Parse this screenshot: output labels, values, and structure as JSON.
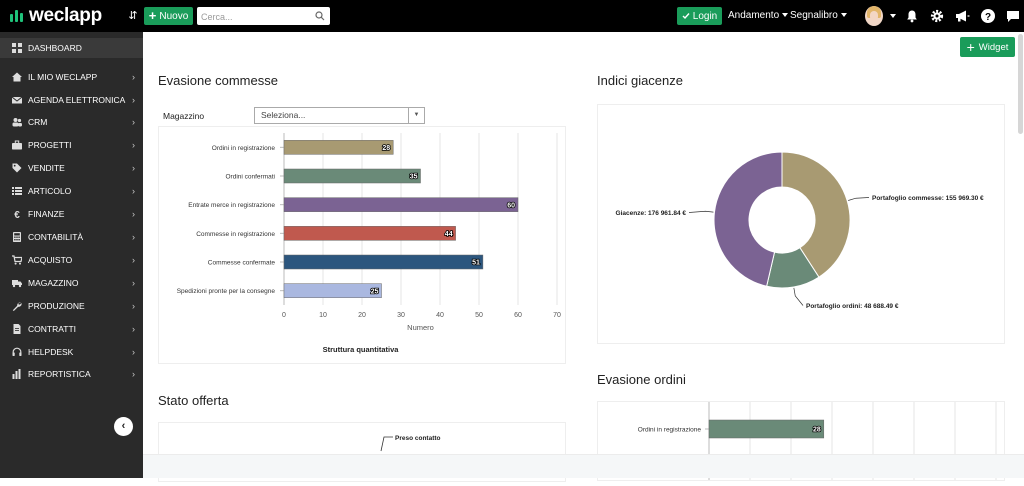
{
  "topbar": {
    "logo_text": "weclapp",
    "collapse_glyph": "⇵",
    "new_button": "Nuovo",
    "search_placeholder": "Cerca...",
    "login_button": "Login",
    "menu_andamento": "Andamento",
    "menu_segnalibro": "Segnalibro",
    "icons": [
      "bell-icon",
      "gear-icon",
      "megaphone-icon",
      "help-icon",
      "chat-icon"
    ]
  },
  "sidebar": {
    "items": [
      {
        "label": "DASHBOARD",
        "icon": "dashboard-icon",
        "active": true,
        "chevron": false
      },
      {
        "label": "IL MIO WECLAPP",
        "icon": "home-icon",
        "chevron": true
      },
      {
        "label": "AGENDA ELETTRONICA",
        "icon": "envelope-icon",
        "chevron": true
      },
      {
        "label": "CRM",
        "icon": "users-icon",
        "chevron": true
      },
      {
        "label": "PROGETTI",
        "icon": "briefcase-icon",
        "chevron": true
      },
      {
        "label": "VENDITE",
        "icon": "tag-icon",
        "chevron": true
      },
      {
        "label": "ARTICOLO",
        "icon": "list-icon",
        "chevron": true
      },
      {
        "label": "FINANZE",
        "icon": "euro-icon",
        "chevron": true
      },
      {
        "label": "CONTABILITÀ",
        "icon": "calculator-icon",
        "chevron": true
      },
      {
        "label": "ACQUISTO",
        "icon": "cart-icon",
        "chevron": true
      },
      {
        "label": "MAGAZZINO",
        "icon": "truck-icon",
        "chevron": true
      },
      {
        "label": "PRODUZIONE",
        "icon": "wrench-icon",
        "chevron": true
      },
      {
        "label": "CONTRATTI",
        "icon": "file-icon",
        "chevron": true
      },
      {
        "label": "HELPDESK",
        "icon": "headset-icon",
        "chevron": true
      },
      {
        "label": "REPORTISTICA",
        "icon": "bar-chart-icon",
        "chevron": true
      }
    ],
    "collapse_glyph": "‹"
  },
  "main": {
    "widget_button": "Widget",
    "evasione_commesse": {
      "title": "Evasione commesse",
      "magazzino_label": "Magazzino",
      "select_value": "Seleziona..."
    },
    "indici_giacenze": {
      "title": "Indici giacenze"
    },
    "stato_offerta": {
      "title": "Stato offerta"
    },
    "evasione_ordini": {
      "title": "Evasione ordini"
    }
  },
  "chart_data": [
    {
      "type": "bar",
      "orientation": "horizontal",
      "categories": [
        "Ordini in registrazione",
        "Ordini confermati",
        "Entrate merce in registrazione",
        "Commesse in registrazione",
        "Commesse confermate",
        "Spedizioni pronte per la consegne"
      ],
      "values": [
        28,
        35,
        60,
        44,
        51,
        25
      ],
      "colors": [
        "#a89a72",
        "#6a8a78",
        "#7b6393",
        "#c0594e",
        "#2c567e",
        "#aab8e0"
      ],
      "xlabel": "Numero",
      "title": "Struttura quantitativa",
      "xlim": [
        0,
        70
      ],
      "ticks": [
        0,
        10,
        20,
        30,
        40,
        50,
        60,
        70
      ],
      "grid": true
    },
    {
      "type": "pie",
      "donut": true,
      "labels": [
        "Portafoglio commesse: 155 969.30 €",
        "Portafoglio ordini: 48 688.49 €",
        "Giacenze: 176 961.84 €"
      ],
      "values": [
        155969.3,
        48688.49,
        176961.84
      ],
      "colors": [
        "#a89a72",
        "#6a8a78",
        "#7b6393"
      ]
    },
    {
      "type": "pie",
      "labels": [
        "Preso contatto"
      ],
      "values": [
        1
      ]
    },
    {
      "type": "bar",
      "orientation": "horizontal",
      "categories": [
        "Ordini in registrazione"
      ],
      "values": [
        28
      ],
      "colors": [
        "#6a8a78"
      ]
    }
  ]
}
